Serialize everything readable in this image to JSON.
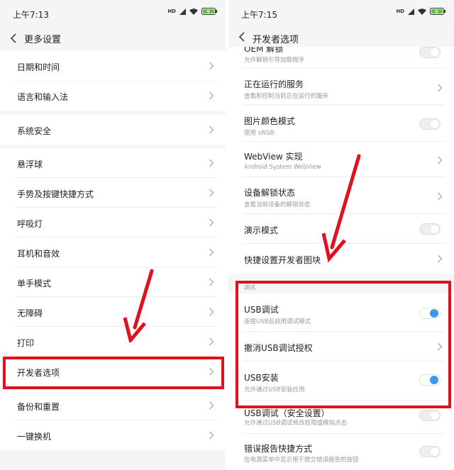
{
  "colors": {
    "accent": "#3e97e8",
    "annotation_red": "#e0111f",
    "background": "#f5f5f5"
  },
  "left": {
    "status": {
      "time": "上午7:13",
      "signal": "HD"
    },
    "title": "更多设置",
    "items": [
      {
        "label": "日期和时间",
        "icon": "chevron-right-icon"
      },
      {
        "label": "语言和输入法",
        "icon": "chevron-right-icon"
      },
      {
        "label": "系统安全",
        "icon": "chevron-right-icon"
      },
      {
        "label": "悬浮球",
        "icon": "chevron-right-icon"
      },
      {
        "label": "手势及按键快捷方式",
        "icon": "chevron-right-icon"
      },
      {
        "label": "呼吸灯",
        "icon": "chevron-right-icon"
      },
      {
        "label": "耳机和音效",
        "icon": "chevron-right-icon"
      },
      {
        "label": "单手模式",
        "icon": "chevron-right-icon"
      },
      {
        "label": "无障碍",
        "icon": "chevron-right-icon"
      },
      {
        "label": "打印",
        "icon": "chevron-right-icon"
      },
      {
        "label": "开发者选项",
        "icon": "chevron-right-icon"
      },
      {
        "label": "备份和重置",
        "icon": "chevron-right-icon"
      },
      {
        "label": "一键换机",
        "icon": "chevron-right-icon"
      }
    ]
  },
  "right": {
    "status": {
      "time": "上午7:15",
      "signal": "HD"
    },
    "title": "开发者选项",
    "items": [
      {
        "label": "OEM 解锁",
        "sub": "允许解锁引导加载程序",
        "control": "toggle-off"
      },
      {
        "label": "正在运行的服务",
        "sub": "查看和控制当前正在运行的服务",
        "control": "chevron"
      },
      {
        "label": "图片颜色模式",
        "sub": "使用 sRGB",
        "control": "toggle-off"
      },
      {
        "label": "WebView 实现",
        "sub": "Android System WebView",
        "control": "chevron"
      },
      {
        "label": "设备解锁状态",
        "sub": "查看当前设备的解锁状态",
        "control": "chevron"
      },
      {
        "label": "演示模式",
        "control": "toggle-off"
      },
      {
        "label": "快捷设置开发者图块",
        "control": "chevron"
      }
    ],
    "debug_section": {
      "header": "调试",
      "items": [
        {
          "label": "USB调试",
          "sub": "连接USB后启用调试模式",
          "control": "toggle-on"
        },
        {
          "label": "撤消USB调试授权",
          "control": "chevron"
        },
        {
          "label": "USB安装",
          "sub": "允许通过USB安装应用",
          "control": "toggle-on"
        },
        {
          "label": "USB调试（安全设置）",
          "sub": "允许通过USB调试修改权限或模拟点击",
          "control": "toggle-off"
        },
        {
          "label": "错误报告快捷方式",
          "sub": "在电源菜单中显示用于提交错误报告的按钮",
          "control": "toggle-off"
        }
      ]
    }
  }
}
